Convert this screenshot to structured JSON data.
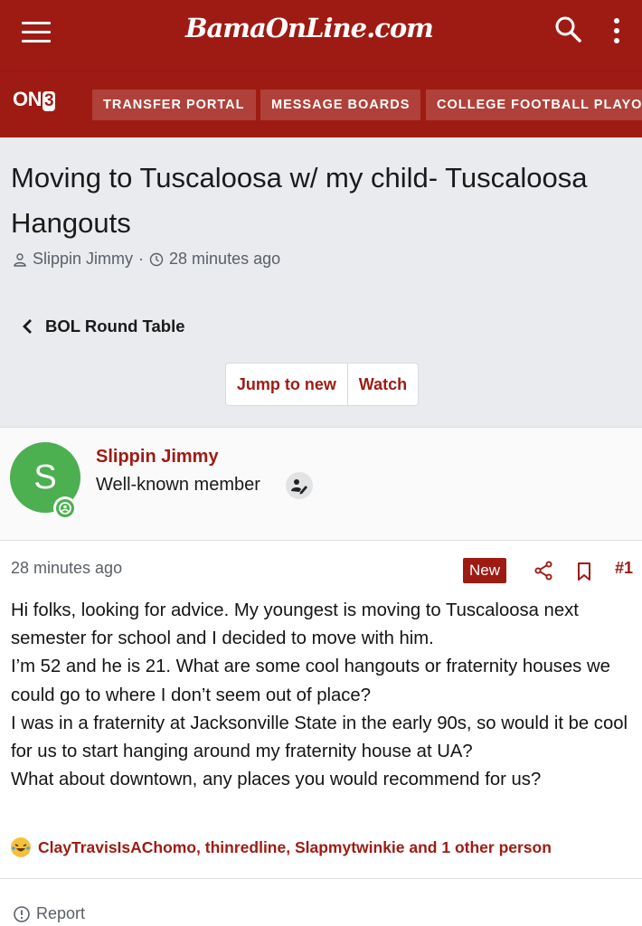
{
  "header": {
    "logo": "BamaOnLine.com",
    "brand": "ON3"
  },
  "nav": {
    "items": [
      "TRANSFER PORTAL",
      "MESSAGE BOARDS",
      "COLLEGE FOOTBALL PLAYOFF"
    ]
  },
  "thread": {
    "title": "Moving to Tuscaloosa w/ my child- Tuscaloosa Hangouts",
    "author": "Slippin Jimmy",
    "separator": "·",
    "time": "28 minutes ago",
    "forum": "BOL Round Table",
    "jump_label": "Jump to new",
    "watch_label": "Watch"
  },
  "post": {
    "avatar_letter": "S",
    "username": "Slippin Jimmy",
    "user_title": "Well-known member",
    "time": "28 minutes ago",
    "new_badge": "New",
    "number": "#1",
    "body": [
      "Hi folks, looking for advice. My youngest is moving to Tuscaloosa next semester for school and I decided to move with him.",
      "I’m 52 and he is 21. What are some cool hangouts or fraternity houses we could go to where I don’t seem out of place?",
      "I was in a fraternity at Jacksonville State in the early 90s, so would it be cool for us to start hanging around my fraternity house at UA?",
      "What about downtown, any places you would recommend for us?"
    ],
    "reactions": "ClayTravisIsAChomo, thinredline, Slapmytwinkie and 1 other person",
    "report_label": "Report"
  },
  "colors": {
    "brand": "#9e1b14",
    "header_bg": "#e9ebee",
    "avatar": "#4caf50"
  },
  "icons": [
    "menu-icon",
    "search-icon",
    "more-vertical-icon",
    "user-icon",
    "clock-icon",
    "chevron-left-icon",
    "user-edit-icon",
    "share-icon",
    "bookmark-icon",
    "laughing-emoji-icon",
    "alert-circle-icon"
  ]
}
